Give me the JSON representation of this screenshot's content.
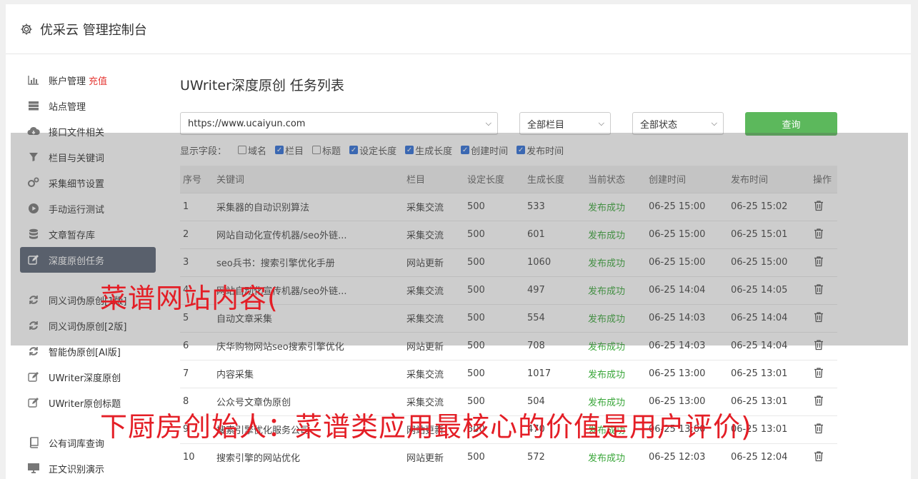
{
  "header": {
    "title": "优采云 管理控制台",
    "icon": "gear-icon"
  },
  "sidebar": {
    "group1": [
      {
        "label": "账户管理",
        "extra": "充值",
        "icon": "bar-chart-icon"
      },
      {
        "label": "站点管理",
        "icon": "server-icon"
      },
      {
        "label": "接口文件相关",
        "icon": "cloud-download-icon"
      },
      {
        "label": "栏目与关键词",
        "icon": "filter-icon"
      },
      {
        "label": "采集细节设置",
        "icon": "gears-icon"
      },
      {
        "label": "手动运行测试",
        "icon": "play-circle-icon"
      },
      {
        "label": "文章暂存库",
        "icon": "database-icon"
      },
      {
        "label": "深度原创任务",
        "icon": "edit-icon",
        "active": true
      }
    ],
    "group2": [
      {
        "label": "同义词伪原创[1版]",
        "icon": "refresh-icon"
      },
      {
        "label": "同义词伪原创[2版]",
        "icon": "refresh-icon"
      },
      {
        "label": "智能伪原创[AI版]",
        "icon": "refresh-icon"
      },
      {
        "label": "UWriter深度原创",
        "icon": "edit-icon"
      },
      {
        "label": "UWriter原创标题",
        "icon": "edit-icon"
      }
    ],
    "group3": [
      {
        "label": "公有词库查询",
        "icon": "book-icon"
      },
      {
        "label": "正文识别演示",
        "icon": "monitor-icon"
      }
    ]
  },
  "main": {
    "title": "UWriter深度原创 任务列表",
    "site_select": "https://www.ucaiyun.com",
    "column_select": "全部栏目",
    "status_select": "全部状态",
    "query_button": "查询",
    "fields_label": "显示字段：",
    "fields": [
      {
        "label": "域名",
        "checked": false
      },
      {
        "label": "栏目",
        "checked": true
      },
      {
        "label": "标题",
        "checked": false
      },
      {
        "label": "设定长度",
        "checked": true
      },
      {
        "label": "生成长度",
        "checked": true
      },
      {
        "label": "创建时间",
        "checked": true
      },
      {
        "label": "发布时间",
        "checked": true
      }
    ],
    "table": {
      "headers": [
        "序号",
        "关键词",
        "栏目",
        "设定长度",
        "生成长度",
        "当前状态",
        "创建时间",
        "发布时间",
        "操作"
      ],
      "rows": [
        [
          "1",
          "采集器的自动识别算法",
          "采集交流",
          "500",
          "533",
          "发布成功",
          "06-25 15:00",
          "06-25 15:02"
        ],
        [
          "2",
          "网站自动化宣传机器/seo外链...",
          "采集交流",
          "500",
          "601",
          "发布成功",
          "06-25 15:00",
          "06-25 15:01"
        ],
        [
          "3",
          "seo兵书：搜索引擎优化手册",
          "网站更新",
          "500",
          "1060",
          "发布成功",
          "06-25 15:00",
          "06-25 15:00"
        ],
        [
          "4",
          "网站自动化宣传机器/seo外链...",
          "采集交流",
          "500",
          "497",
          "发布成功",
          "06-25 14:04",
          "06-25 14:05"
        ],
        [
          "5",
          "自动文章采集",
          "采集交流",
          "500",
          "554",
          "发布成功",
          "06-25 14:03",
          "06-25 14:04"
        ],
        [
          "6",
          "庆华购物网站seo搜索引擎优化",
          "网站更新",
          "500",
          "708",
          "发布成功",
          "06-25 14:03",
          "06-25 14:04"
        ],
        [
          "7",
          "内容采集",
          "采集交流",
          "500",
          "1017",
          "发布成功",
          "06-25 13:00",
          "06-25 13:01"
        ],
        [
          "8",
          "公众号文章伪原创",
          "采集交流",
          "500",
          "504",
          "发布成功",
          "06-25 13:00",
          "06-25 13:01"
        ],
        [
          "9",
          "搜索引擎优化服务公司",
          "网站更新",
          "500",
          "470",
          "发布成功",
          "06-25 13:00",
          "06-25 13:01"
        ],
        [
          "10",
          "搜索引擎的网站优化",
          "网站更新",
          "500",
          "572",
          "发布成功",
          "06-25 12:03",
          "06-25 12:04"
        ]
      ]
    }
  },
  "watermark": {
    "line1": "菜谱网站内容(",
    "line2": "下厨房创始人：菜谱类应用最核心的价值是用户评价)"
  },
  "colors": {
    "accent_green": "#5cb85c",
    "active_bg": "#5a6475",
    "status_ok": "#3aa63a",
    "watermark": "#e41e26"
  }
}
